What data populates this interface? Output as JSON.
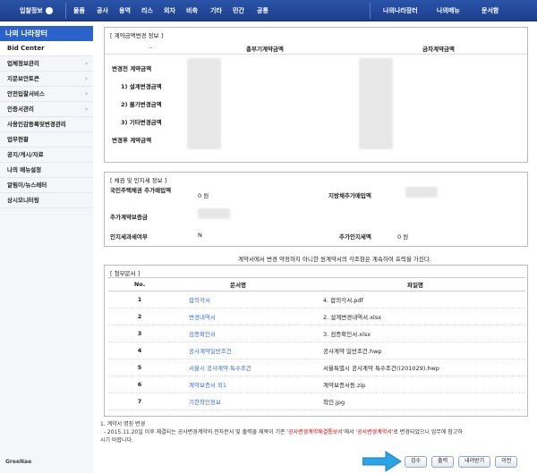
{
  "topnav": {
    "left": [
      "입찰정보",
      "물품",
      "공사",
      "용역",
      "리스",
      "외자",
      "비축",
      "기타",
      "민간",
      "공통"
    ],
    "right": [
      "나의나라장터",
      "나의메뉴",
      "문서함"
    ]
  },
  "sidebar": {
    "title": "나의 나라장터",
    "items": [
      {
        "label": "Bid Center",
        "arrow": ""
      },
      {
        "label": "업체정보관리",
        "arrow": "›"
      },
      {
        "label": "지문보안토큰",
        "arrow": "›"
      },
      {
        "label": "안전입찰서비스",
        "arrow": "›"
      },
      {
        "label": "인증서관리",
        "arrow": "›"
      },
      {
        "label": "사용인감등록및변경관리",
        "arrow": ""
      },
      {
        "label": "업무현황",
        "arrow": ""
      },
      {
        "label": "공지/게시/자료",
        "arrow": ""
      },
      {
        "label": "나의 메뉴설정",
        "arrow": ""
      },
      {
        "label": "알림이/뉴스레터",
        "arrow": ""
      },
      {
        "label": "상시모니터링",
        "arrow": ""
      }
    ],
    "footer_logo": "GreeNae"
  },
  "contract_change": {
    "title": "[ 계약금액변경 정보 ]",
    "dash": "-",
    "col_total": "총부기계약금액",
    "col_this": "금차계약금액",
    "rows": [
      "변경전 계약금액",
      "1) 설계변경금액",
      "2) 물가변경금액",
      "3) 기타변경금액",
      "변경후 계약금액"
    ]
  },
  "bond": {
    "title": "[ 채권 및 인지세 정보 ]",
    "national_label": "국민주택채권 추가매입액",
    "national_value": "0 원",
    "local_label": "지방채추가매입액",
    "extra_label": "추가계약보증금",
    "stamp_label": "인지세과세여부",
    "stamp_value": "N",
    "stamp_amount_label": "추가인지세액",
    "stamp_amount_value": "0 원",
    "notice": "계약서에서 변경 약정하지 아니한 원계약서의 각조항은 계속하여 효력을 가진다."
  },
  "attachments": {
    "title": "[ 첨부문서 ]",
    "headers": {
      "no": "No.",
      "doc": "문서명",
      "file": "파일명"
    },
    "rows": [
      {
        "no": "1",
        "doc": "합의각서",
        "file": "4. 합의각서.pdf"
      },
      {
        "no": "2",
        "doc": "변경내역서",
        "file": "2. 설계변경내역서.xlsx"
      },
      {
        "no": "3",
        "doc": "검증확인서",
        "file": "3. 검증확인서.xlsx"
      },
      {
        "no": "4",
        "doc": "공사계약일반조건",
        "file": "공사계약 일반조건.hwp"
      },
      {
        "no": "5",
        "doc": "서울시 공사계약 특수조건",
        "file": "서울특별시 공사계약 특수조건((201029).hwp"
      },
      {
        "no": "6",
        "doc": "계약보증서 외1",
        "file": "계약보증서등.zip"
      },
      {
        "no": "7",
        "doc": "기한착인정보",
        "file": "착인.jpg"
      }
    ]
  },
  "notes": {
    "line1": "1. 계약서 명칭 변경",
    "line2a": "- 2015.11.20일 이후 체결되는 공사변경계약의 전자문서 및 출력물 제목이 기존 '",
    "red1": "공사변경계약체결통보서",
    "line2b": "'에서 '",
    "red2": "공사변경계약서",
    "line2c": "'로 변경되었으니 업무에 참고하",
    "line3": "시기 바랍니다."
  },
  "buttons": [
    "검수",
    "출력",
    "내려받기",
    "이전"
  ]
}
